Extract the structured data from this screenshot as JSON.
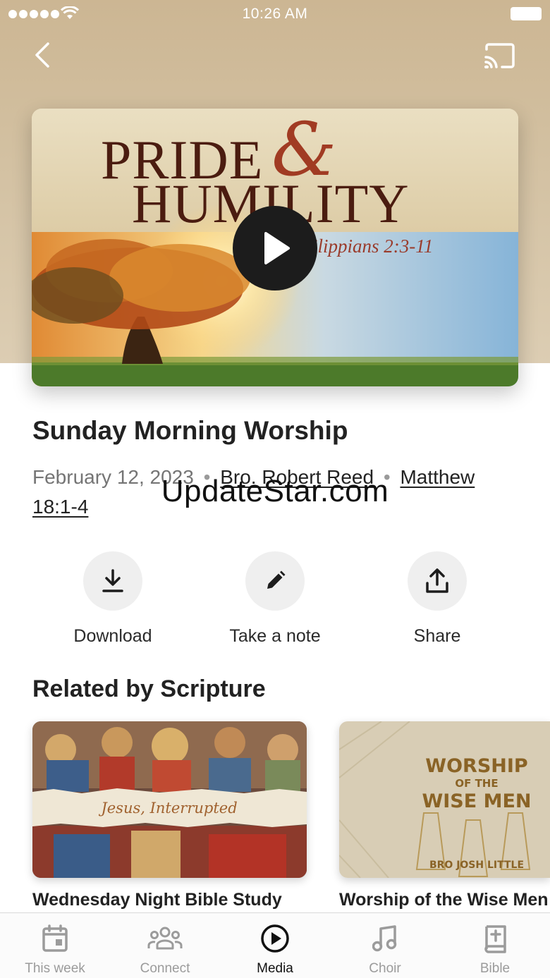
{
  "status_bar": {
    "time": "10:26 AM"
  },
  "hero": {
    "artwork_title_line1": "PRIDE",
    "artwork_ampersand": "&",
    "artwork_title_line2": "HUMILITY",
    "artwork_reference": "Philippians 2:3-11"
  },
  "sermon": {
    "title": "Sunday Morning Worship",
    "date": "February 12, 2023",
    "separator": "•",
    "speaker": "Bro. Robert Reed",
    "scripture": "Matthew 18:1-4"
  },
  "watermark": "UpdateStar.com",
  "actions": [
    {
      "label": "Download",
      "icon": "download-icon"
    },
    {
      "label": "Take a note",
      "icon": "pencil-icon"
    },
    {
      "label": "Share",
      "icon": "share-icon"
    }
  ],
  "related": {
    "heading": "Related by Scripture",
    "items": [
      {
        "title": "Wednesday Night Bible Study",
        "artwork_text": "Jesus, Interrupted"
      },
      {
        "title": "Worship of the Wise Men",
        "artwork_text": "WORSHIP OF THE WISE MEN",
        "artwork_subtext": "BRO JOSH LITTLE"
      }
    ]
  },
  "tabs": [
    {
      "label": "This week",
      "icon": "calendar-icon",
      "active": false
    },
    {
      "label": "Connect",
      "icon": "people-icon",
      "active": false
    },
    {
      "label": "Media",
      "icon": "play-circle-icon",
      "active": true
    },
    {
      "label": "Choir",
      "icon": "music-note-icon",
      "active": false
    },
    {
      "label": "Bible",
      "icon": "bible-icon",
      "active": false
    }
  ],
  "colors": {
    "hero_background": "#d3c1a2",
    "text_primary": "#222222",
    "text_secondary": "#757575",
    "tab_active": "#111111",
    "tab_inactive": "#9b9b9b",
    "action_circle": "#efefef"
  }
}
